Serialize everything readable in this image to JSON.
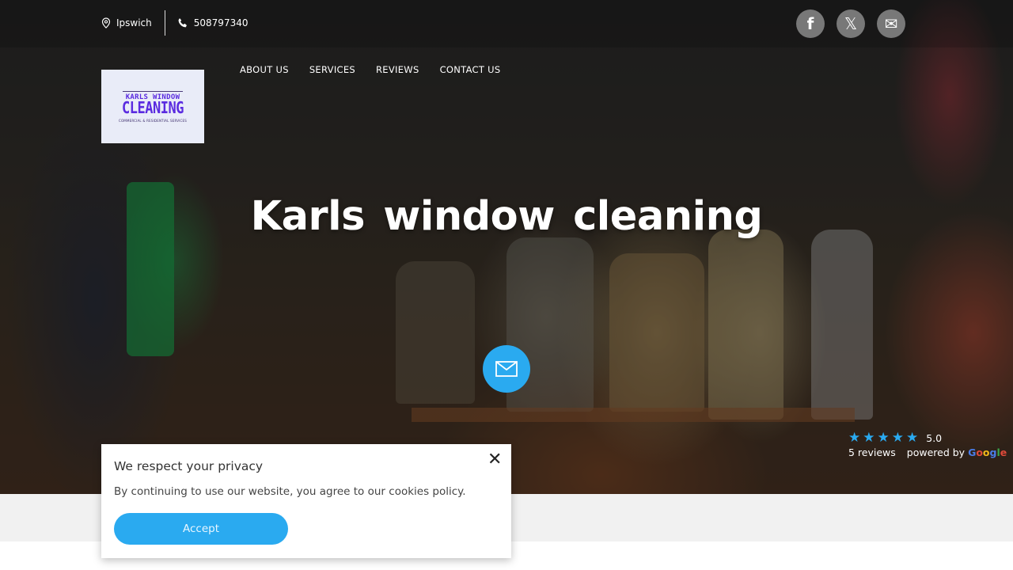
{
  "topbar": {
    "location_icon": "map-pin-icon",
    "location": "Ipswich",
    "phone_icon": "phone-icon",
    "phone": "508797340"
  },
  "social": [
    {
      "name": "facebook",
      "icon": "facebook-icon",
      "glyph": "f"
    },
    {
      "name": "x",
      "icon": "x-twitter-icon",
      "glyph": "𝕏"
    },
    {
      "name": "email",
      "icon": "mail-icon",
      "glyph": "✉"
    }
  ],
  "logo": {
    "line1": "KARLS WINDOW",
    "line2": "CLEANING",
    "line3": "COMMERCIAL & RESIDENTIAL SERVICES"
  },
  "nav": [
    {
      "label": "ABOUT US"
    },
    {
      "label": "SERVICES"
    },
    {
      "label": "REVIEWS"
    },
    {
      "label": "CONTACT US"
    }
  ],
  "hero": {
    "title": "Karls window cleaning",
    "fab_icon": "mail-icon"
  },
  "rating": {
    "stars": 5,
    "score": "5.0",
    "reviews": "5 reviews",
    "powered_by": "powered by",
    "provider": "Google",
    "star_color": "#2aaaf0"
  },
  "cookie": {
    "title": "We respect your privacy",
    "message": "By continuing to use our website, you agree to our cookies policy.",
    "accept_label": "Accept",
    "close_icon": "close-icon",
    "accent": "#2aaaf0"
  }
}
